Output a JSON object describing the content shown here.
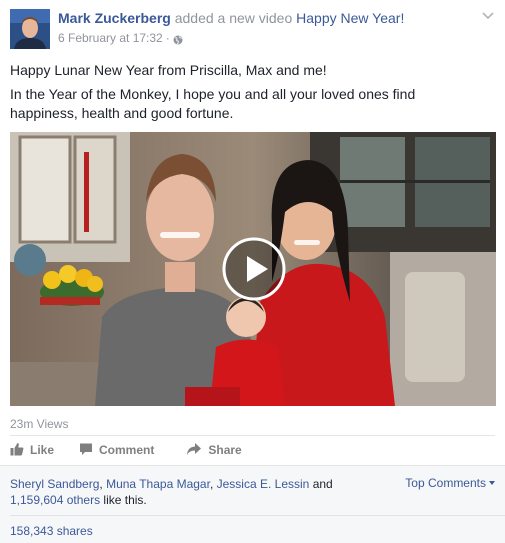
{
  "post": {
    "author": "Mark Zuckerberg",
    "action": "added a new video",
    "video_title": "Happy New Year!",
    "timestamp": "6 February at 17:32",
    "separator": "·",
    "privacy_icon": "globe-icon",
    "text_line1": "Happy Lunar New Year from Priscilla, Max and me!",
    "text_line2": "In the Year of the Monkey, I hope you and all your loved ones find happiness, health and good fortune.",
    "views": "23m Views"
  },
  "actions": {
    "like": "Like",
    "comment": "Comment",
    "share": "Share"
  },
  "reactions": {
    "name1": "Sheryl Sandberg",
    "comma1": ",",
    "name2": "Muna Thapa Magar",
    "comma2": ",",
    "name3": "Jessica E. Lessin",
    "and": "and",
    "others": "1,159,604 others",
    "like_this": "like this.",
    "top_comments": "Top Comments",
    "shares": "158,343 shares"
  },
  "colors": {
    "link": "#3b5998",
    "muted": "#90949c",
    "footer_bg": "#f6f7f9"
  }
}
